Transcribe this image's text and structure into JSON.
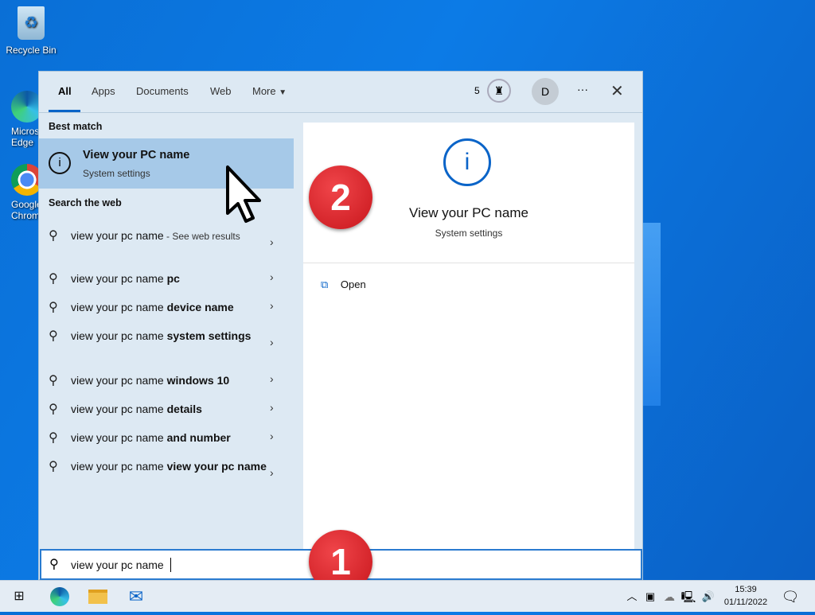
{
  "desktop": {
    "icons": [
      {
        "label": "Recycle Bin"
      },
      {
        "label": "Microsoft Edge"
      },
      {
        "label": "Google Chrome"
      }
    ]
  },
  "search": {
    "tabs": [
      {
        "label": "All",
        "active": true
      },
      {
        "label": "Apps"
      },
      {
        "label": "Documents"
      },
      {
        "label": "Web"
      },
      {
        "label": "More"
      }
    ],
    "points": "5",
    "avatar": "D",
    "more_options": "···",
    "best_match_header": "Best match",
    "best_match": {
      "title": "View your PC name",
      "subtitle": "System settings"
    },
    "web_header": "Search the web",
    "web_results": [
      {
        "text": "view your pc name",
        "bold": "",
        "suffix": " - See web results"
      },
      {
        "text": "view your pc name ",
        "bold": "pc",
        "suffix": ""
      },
      {
        "text": "view your pc name ",
        "bold": "device name",
        "suffix": ""
      },
      {
        "text": "view your pc name ",
        "bold": "system settings",
        "suffix": ""
      },
      {
        "text": "view your pc name ",
        "bold": "windows 10",
        "suffix": ""
      },
      {
        "text": "view your pc name ",
        "bold": "details",
        "suffix": ""
      },
      {
        "text": "view your pc name ",
        "bold": "and number",
        "suffix": ""
      },
      {
        "text": "view your pc name ",
        "bold": "view your pc name",
        "suffix": ""
      }
    ],
    "preview": {
      "title": "View your PC name",
      "subtitle": "System settings",
      "action": "Open"
    },
    "query": "view your pc name"
  },
  "annotations": {
    "step1": "1",
    "step2": "2",
    "color": "#d9252b"
  },
  "taskbar": {
    "time": "15:39",
    "date": "01/11/2022"
  },
  "colors": {
    "accent": "#0a64c8",
    "selected": "#a6c9e8"
  }
}
